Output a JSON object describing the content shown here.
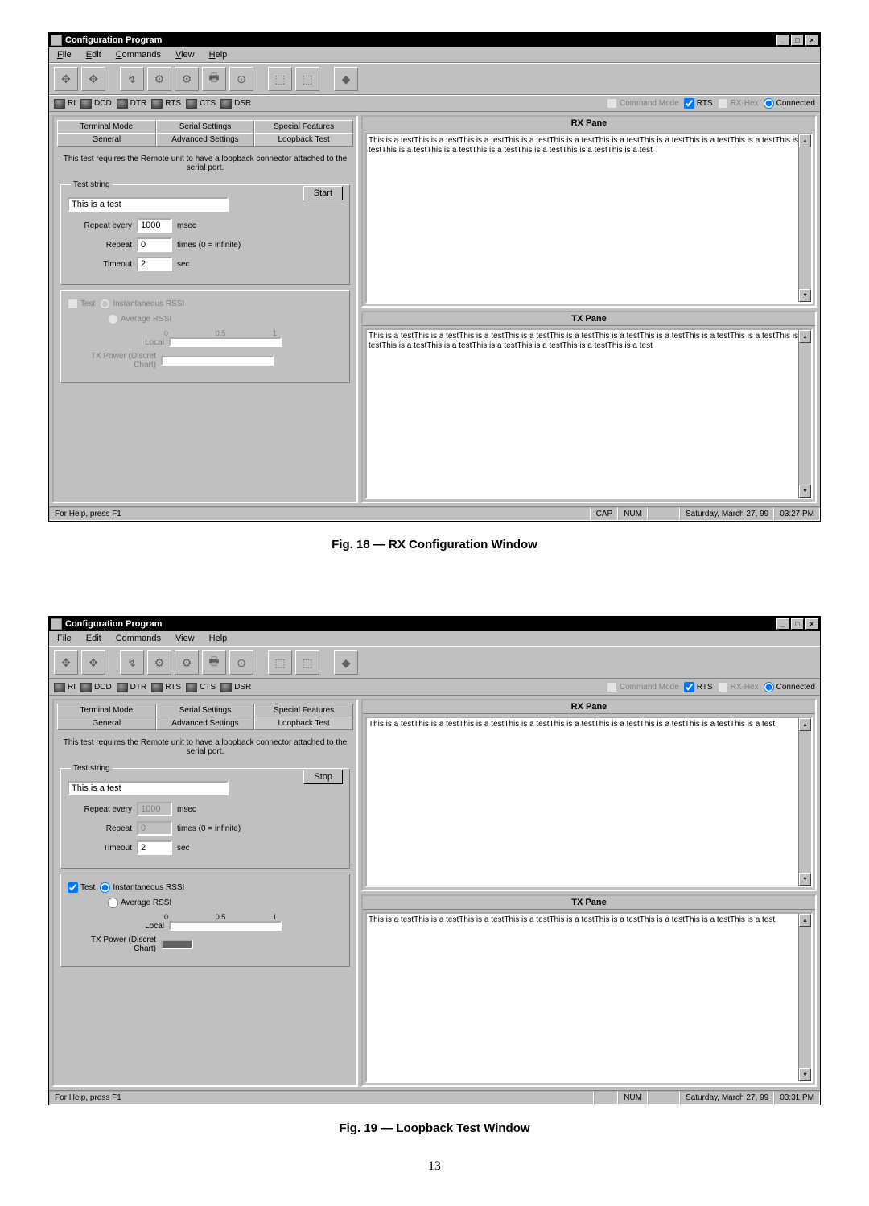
{
  "app_title": "Configuration Program",
  "menus": [
    "File",
    "Edit",
    "Commands",
    "View",
    "Help"
  ],
  "status_indicators": {
    "ri": "RI",
    "dcd": "DCD",
    "dtr": "DTR",
    "rts": "RTS",
    "cts": "CTS",
    "dsr": "DSR"
  },
  "status_right": {
    "command_mode": "Command Mode",
    "rts": "RTS",
    "rxhex": "RX-Hex",
    "connected": "Connected"
  },
  "tabs_row1": [
    "Terminal Mode",
    "Serial Settings",
    "Special Features"
  ],
  "tabs_row2": [
    "General",
    "Advanced Settings",
    "Loopback Test"
  ],
  "instruction": "This test requires the Remote unit to have a loopback connector attached to the serial port.",
  "test_string_legend": "Test string",
  "form": {
    "test_value": "This is a test",
    "repeat_every_label": "Repeat every",
    "repeat_every_value": "1000",
    "repeat_every_unit": "msec",
    "repeat_label": "Repeat",
    "repeat_value": "0",
    "repeat_unit": "times  (0 = infinite)",
    "timeout_label": "Timeout",
    "timeout_value": "2",
    "timeout_unit": "sec",
    "start_btn": "Start",
    "stop_btn": "Stop"
  },
  "rssi": {
    "test_label": "Test",
    "inst_label": "Instantaneous RSSI",
    "avg_label": "Average RSSI",
    "scale0": "0",
    "scale05": "0.5",
    "scale1": "1",
    "local_label": "Local",
    "txpower_label": "TX Power (Discret Chart)"
  },
  "rx": {
    "title": "RX Pane",
    "text18": "This is a testThis is a testThis is a testThis is a testThis is a testThis is a testThis is a testThis is a testThis is a testThis is a testThis is a testThis is a testThis is a testThis is a testThis is a testThis is a test",
    "text19": "This is a testThis is a testThis is a testThis is a testThis is a testThis is a testThis is a testThis is a testThis is a test"
  },
  "tx": {
    "title": "TX Pane",
    "text18": "This is a testThis is a testThis is a testThis is a testThis is a testThis is a testThis is a testThis is a testThis is a testThis is a testThis is a testThis is a testThis is a testThis is a testThis is a testThis is a test",
    "text19": "This is a testThis is a testThis is a testThis is a testThis is a testThis is a testThis is a testThis is a testThis is a test"
  },
  "statusbar": {
    "help": "For Help, press F1",
    "cap": "CAP",
    "num": "NUM",
    "date": "Saturday, March 27, 99",
    "time18": "03:27 PM",
    "time19": "03:31 PM"
  },
  "figure18": "Fig. 18 — RX Configuration Window",
  "figure19": "Fig. 19 — Loopback Test Window",
  "page_number": "13"
}
